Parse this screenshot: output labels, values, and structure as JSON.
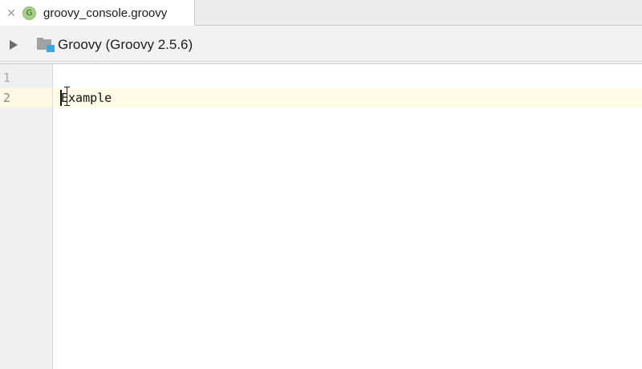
{
  "tabs": [
    {
      "label": "groovy_console.groovy",
      "icon": "groovy-file-icon",
      "icon_letter": "G",
      "close_glyph": "✕",
      "active": true
    }
  ],
  "toolbar": {
    "run_icon": "play-icon",
    "sdk_icon": "module-icon",
    "sdk_label": "Groovy (Groovy 2.5.6)"
  },
  "editor": {
    "line_numbers": [
      "1",
      "2"
    ],
    "current_line": 2,
    "lines": [
      "",
      "Example"
    ],
    "colors": {
      "current_line_bg": "#fffbe6",
      "gutter_bg": "#f0f0f0",
      "groovy_icon": "#a7cf8b",
      "module_badge": "#3fa6e0"
    }
  }
}
